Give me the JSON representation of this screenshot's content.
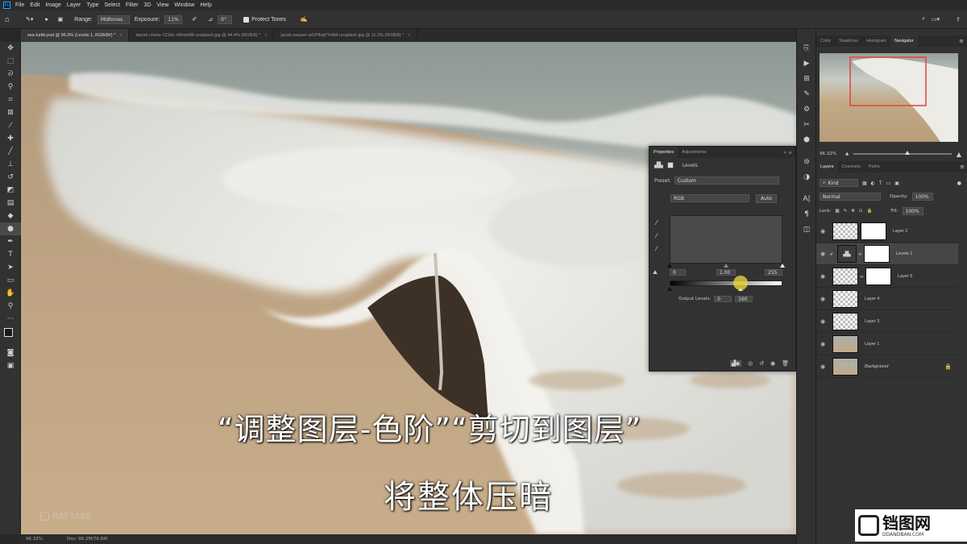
{
  "menu": {
    "app_icon": "Ps",
    "items": [
      "File",
      "Edit",
      "Image",
      "Layer",
      "Type",
      "Select",
      "Filter",
      "3D",
      "View",
      "Window",
      "Help"
    ]
  },
  "options_bar": {
    "range_label": "Range:",
    "range_value": "Midtones",
    "exposure_label": "Exposure:",
    "exposure_value": "11%",
    "angle_value": "0°",
    "protect_tones_label": "Protect Tones"
  },
  "tabs": [
    {
      "label": "sea turtle.psd @ 96.3% (Levels 1, RGB/8#) *",
      "active": true
    },
    {
      "label": "daniel-cheke-7Z2dc-nNhmM8-unsplash.jpg @ 44.4% (RGB/8) *",
      "active": false
    },
    {
      "label": "jacob-sawyer-wGPfhqFYHb8-unsplash.jpg @ 11.2% (RGB/8) *",
      "active": false
    }
  ],
  "status": {
    "zoom": "96.32%",
    "doc": "Doc: 96.2M/76.6M"
  },
  "watermark": {
    "handle": "RAFYA88",
    "site_big": "铛图网",
    "site_small": "DDANDBAN.COM"
  },
  "subtitles": {
    "line1": "“调整图层-色阶”“剪切到图层”",
    "line2": "将整体压暗"
  },
  "navigator": {
    "tabs": [
      "Color",
      "Swatches",
      "Histogram",
      "Navigator"
    ],
    "active": "Navigator",
    "zoom": "96.32%",
    "zoom_level": 0.55
  },
  "properties": {
    "tabs": [
      "Properties",
      "Adjustments"
    ],
    "active": "Properties",
    "title": "Levels",
    "preset_label": "Preset:",
    "preset_value": "Custom",
    "channel": "RGB",
    "auto_label": "Auto",
    "input_black": "0",
    "input_mid": "1.00",
    "input_white": "255",
    "output_label": "Output Levels:",
    "output_black": "0",
    "output_white": "160",
    "output_white_level": 0.63
  },
  "layers": {
    "tabs": [
      "Layers",
      "Channels",
      "Paths"
    ],
    "active": "Layers",
    "filter_kind": "Kind",
    "blend_mode": "Normal",
    "opacity_label": "Opacity:",
    "opacity_value": "100%",
    "lock_label": "Lock:",
    "fill_label": "Fill:",
    "fill_value": "100%",
    "items": [
      {
        "name": "Layer 2",
        "selected": false
      },
      {
        "name": "Levels 1",
        "selected": true
      },
      {
        "name": "Layer 5",
        "selected": false
      },
      {
        "name": "Layer 4",
        "selected": false
      },
      {
        "name": "Layer 3",
        "selected": false
      },
      {
        "name": "Layer 1",
        "selected": false
      },
      {
        "name": "Background",
        "selected": false
      }
    ]
  }
}
